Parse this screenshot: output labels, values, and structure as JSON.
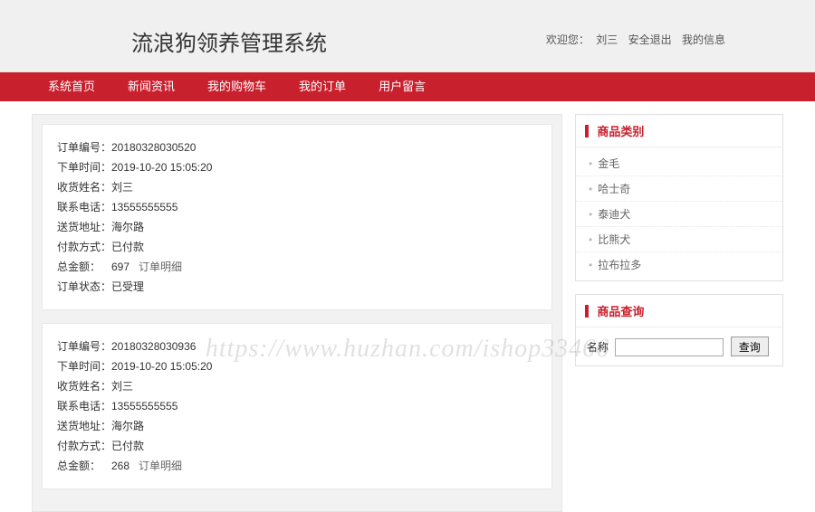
{
  "header": {
    "site_title": "流浪狗领养管理系统",
    "welcome_prefix": "欢迎您：",
    "username": "刘三",
    "logout": "安全退出",
    "my_info": "我的信息"
  },
  "nav": {
    "items": [
      {
        "label": "系统首页"
      },
      {
        "label": "新闻资讯"
      },
      {
        "label": "我的购物车"
      },
      {
        "label": "我的订单"
      },
      {
        "label": "用户留言"
      }
    ]
  },
  "sidebar": {
    "cat_title": "商品类别",
    "categories": [
      {
        "label": "金毛"
      },
      {
        "label": "哈士奇"
      },
      {
        "label": "泰迪犬"
      },
      {
        "label": "比熊犬"
      },
      {
        "label": "拉布拉多"
      }
    ],
    "search_title": "商品查询",
    "search_label": "名称",
    "search_placeholder": "",
    "search_button": "查询"
  },
  "orders": {
    "labels": {
      "order_no": "订单编号：",
      "order_time": "下单时间：",
      "name": "收货姓名：",
      "phone": "联系电话：",
      "address": "送货地址：",
      "pay": "付款方式：",
      "total": "总金额：",
      "detail": "订单明细",
      "status": "订单状态："
    },
    "list": [
      {
        "order_no": "20180328030520",
        "order_time": "2019-10-20 15:05:20",
        "name": "刘三",
        "phone": "13555555555",
        "address": "海尔路",
        "pay": "已付款",
        "total": "697",
        "status": "已受理"
      },
      {
        "order_no": "20180328030936",
        "order_time": "2019-10-20 15:05:20",
        "name": "刘三",
        "phone": "13555555555",
        "address": "海尔路",
        "pay": "已付款",
        "total": "268",
        "status": ""
      }
    ]
  },
  "watermark": "https://www.huzhan.com/ishop33466"
}
